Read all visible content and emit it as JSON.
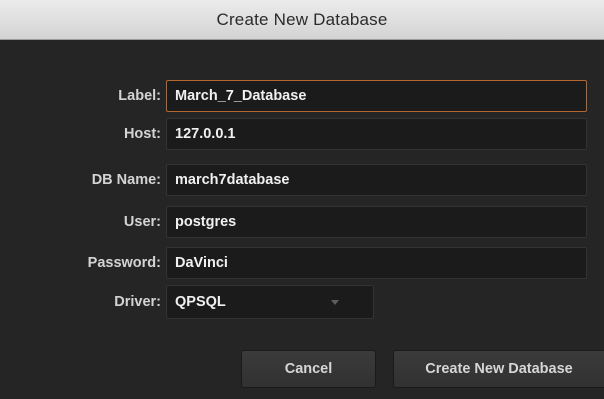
{
  "dialog": {
    "title": "Create New Database"
  },
  "form": {
    "label": {
      "caption": "Label:",
      "value": "March_7_Database"
    },
    "host": {
      "caption": "Host:",
      "value": "127.0.0.1"
    },
    "db_name": {
      "caption": "DB Name:",
      "value": "march7database"
    },
    "user": {
      "caption": "User:",
      "value": "postgres"
    },
    "password": {
      "caption": "Password:",
      "value": "DaVinci"
    },
    "driver": {
      "caption": "Driver:",
      "selected": "QPSQL"
    }
  },
  "buttons": {
    "cancel": "Cancel",
    "create": "Create New Database"
  },
  "colors": {
    "focus_border": "#b5672c",
    "background": "#252525"
  },
  "icons": {
    "driver_dropdown": "chevron-down-icon"
  }
}
